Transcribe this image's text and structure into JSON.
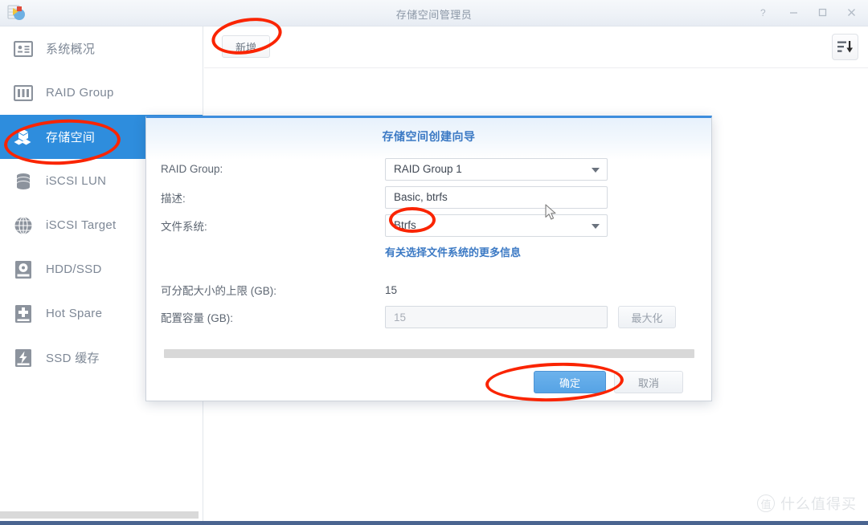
{
  "window": {
    "title": "存储空间管理员",
    "app_icon": "synology-storage-manager-icon",
    "controls": [
      {
        "name": "help-button",
        "glyph": "?"
      },
      {
        "name": "minimize-button",
        "glyph": "–"
      },
      {
        "name": "maximize-button",
        "glyph": "□"
      },
      {
        "name": "close-button",
        "glyph": "✕"
      }
    ]
  },
  "sidebar": {
    "items": [
      {
        "label": "系统概况",
        "icon": "system-overview-icon",
        "selected": false
      },
      {
        "label": "RAID Group",
        "icon": "raid-group-icon",
        "selected": false
      },
      {
        "label": "存储空间",
        "icon": "storage-volume-icon",
        "selected": true
      },
      {
        "label": "iSCSI LUN",
        "icon": "iscsi-lun-icon",
        "selected": false
      },
      {
        "label": "iSCSI Target",
        "icon": "iscsi-target-icon",
        "selected": false
      },
      {
        "label": "HDD/SSD",
        "icon": "hdd-ssd-icon",
        "selected": false
      },
      {
        "label": "Hot Spare",
        "icon": "hot-spare-icon",
        "selected": false
      },
      {
        "label": "SSD 缓存",
        "icon": "ssd-cache-icon",
        "selected": false
      }
    ]
  },
  "toolbar": {
    "new_label": "新增",
    "sort_icon": "sort-descending-icon"
  },
  "dialog": {
    "title": "存储空间创建向导",
    "fields": {
      "raid_group_label": "RAID Group:",
      "raid_group_value": "RAID Group 1",
      "description_label": "描述:",
      "description_value": "Basic, btrfs",
      "filesystem_label": "文件系统:",
      "filesystem_value": "Btrfs",
      "filesystem_help_link": "有关选择文件系统的更多信息",
      "max_alloc_label": "可分配大小的上限 (GB):",
      "max_alloc_value": "15",
      "capacity_label": "配置容量 (GB):",
      "capacity_value": "15",
      "maximize_button": "最大化"
    },
    "buttons": {
      "ok": "确定",
      "cancel": "取消"
    }
  },
  "annotations": {
    "color": "#fa2400",
    "targets": [
      "new-button",
      "sidebar-item-storage-volume",
      "filesystem-value",
      "ok-button"
    ]
  },
  "watermark": {
    "badge": "值",
    "text": "什么值得买"
  },
  "colors": {
    "accent_blue": "#2e8ddd",
    "dialog_border_top": "#3d8ddd",
    "link_blue": "#3b79c4",
    "annotation_red": "#fa2400",
    "sidebar_text": "#7e8896"
  }
}
